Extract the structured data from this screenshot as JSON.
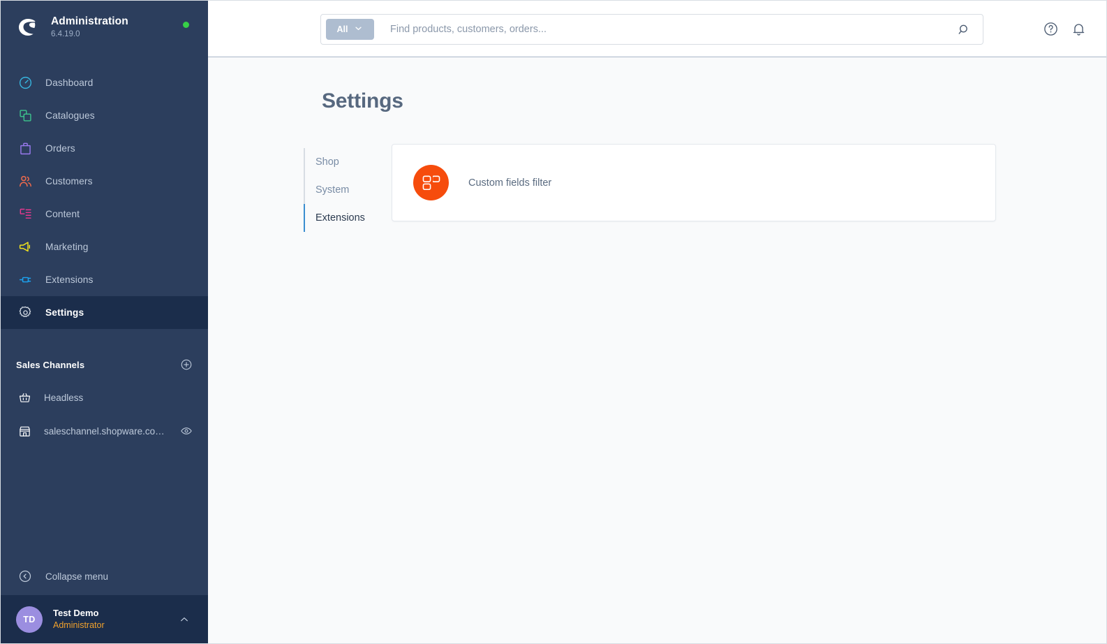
{
  "sidebar": {
    "brand": {
      "logo_icon": "shopware-logo-icon",
      "title": "Administration",
      "version": "6.4.19.0",
      "status_icon": "status-dot-online"
    },
    "nav_items": [
      {
        "label": "Dashboard",
        "icon": "dashboard-icon",
        "color": "#37b6e0",
        "active": false
      },
      {
        "label": "Catalogues",
        "icon": "catalogues-icon",
        "color": "#3dc58d",
        "active": false
      },
      {
        "label": "Orders",
        "icon": "orders-icon",
        "color": "#9a7af0",
        "active": false
      },
      {
        "label": "Customers",
        "icon": "customers-icon",
        "color": "#ef6a4c",
        "active": false
      },
      {
        "label": "Content",
        "icon": "content-icon",
        "color": "#e8388f",
        "active": false
      },
      {
        "label": "Marketing",
        "icon": "marketing-icon",
        "color": "#f2e21d",
        "active": false
      },
      {
        "label": "Extensions",
        "icon": "extensions-icon",
        "color": "#1ba4f2",
        "active": false
      },
      {
        "label": "Settings",
        "icon": "settings-gear-icon",
        "color": "#d4dbe4",
        "active": true
      }
    ],
    "sales_channels": {
      "title": "Sales Channels",
      "add_icon": "plus-circle-icon",
      "items": [
        {
          "label": "Headless",
          "icon": "basket-icon",
          "has_eye": false
        },
        {
          "label": "saleschannel.shopware.co…",
          "icon": "storefront-icon",
          "has_eye": true,
          "eye_icon": "eye-icon"
        }
      ]
    },
    "collapse": {
      "label": "Collapse menu",
      "icon": "collapse-left-icon"
    },
    "user": {
      "initials": "TD",
      "name": "Test Demo",
      "role": "Administrator",
      "caret_icon": "chevron-up-icon"
    }
  },
  "topbar": {
    "search": {
      "scope_label": "All",
      "scope_caret_icon": "chevron-down-icon",
      "placeholder": "Find products, customers, orders...",
      "value": "",
      "search_icon": "search-icon"
    },
    "actions": [
      {
        "icon": "help-circle-icon",
        "name": "help-button"
      },
      {
        "icon": "bell-icon",
        "name": "notifications-button"
      }
    ]
  },
  "main": {
    "page_title": "Settings",
    "sub_nav": [
      {
        "label": "Shop",
        "active": false
      },
      {
        "label": "System",
        "active": false
      },
      {
        "label": "Extensions",
        "active": true
      }
    ],
    "extension_cards": [
      {
        "label": "Custom fields filter",
        "icon": "gb-extension-logo-icon",
        "icon_bg": "#f64c0c"
      }
    ]
  },
  "colors": {
    "sidebar_bg": "#2c3e5d",
    "sidebar_active_bg": "#1b2d4b",
    "content_bg": "#f9fafb",
    "accent_blue": "#3a8ed0",
    "brand_orange": "#f64c0c",
    "role_orange": "#f0a12c",
    "avatar_purple": "#9b8ee0",
    "status_green": "#37d047"
  }
}
